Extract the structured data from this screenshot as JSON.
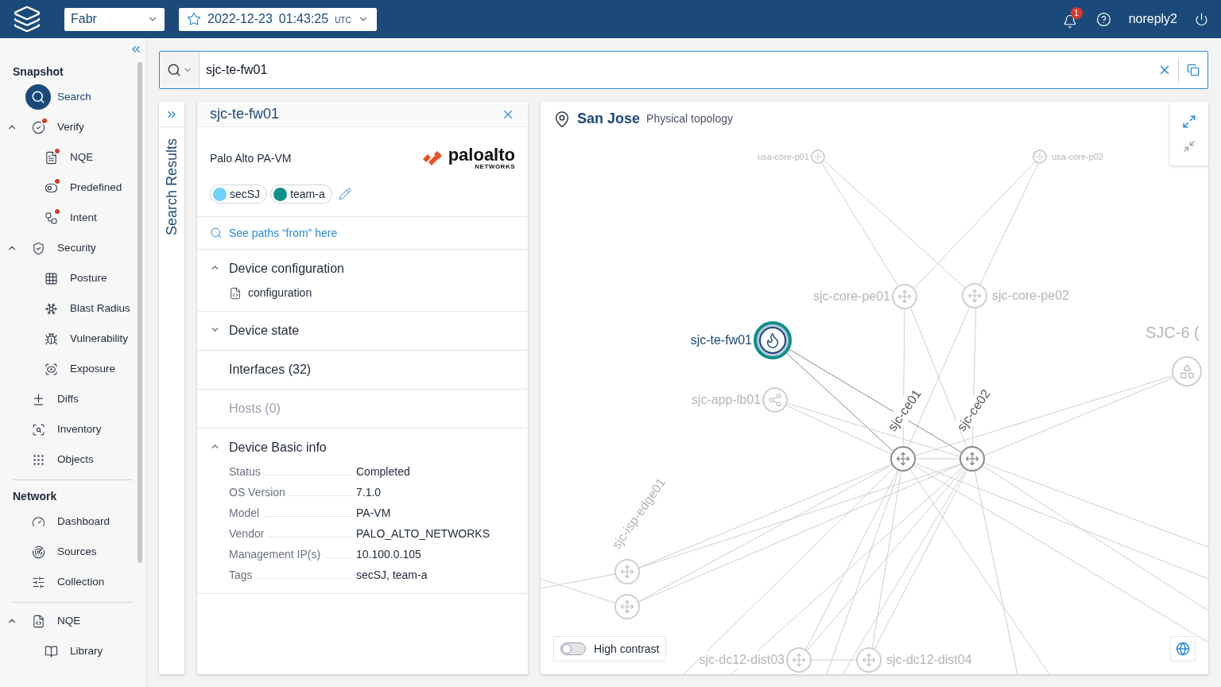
{
  "top_bar": {
    "network_select": "Fabr",
    "snapshot": {
      "date": "2022-12-23",
      "time": "01:43:25",
      "zone": "UTC",
      "starred": false
    },
    "notifications": {
      "count": "1"
    },
    "user": "noreply2"
  },
  "sidebar": {
    "sections": [
      {
        "title": "Snapshot",
        "items": [
          {
            "label": "Search",
            "selected": true,
            "alert": false
          },
          {
            "label": "Verify",
            "selected": false,
            "alert": true,
            "expanded": true,
            "children": [
              {
                "label": "NQE",
                "selected": false,
                "alert": true
              },
              {
                "label": "Predefined",
                "selected": false,
                "alert": true
              },
              {
                "label": "Intent",
                "selected": false,
                "alert": true
              }
            ]
          },
          {
            "label": "Security",
            "selected": false,
            "alert": false,
            "expanded": true,
            "children": [
              {
                "label": "Posture",
                "selected": false,
                "alert": false
              },
              {
                "label": "Blast Radius",
                "selected": false,
                "alert": false
              },
              {
                "label": "Vulnerability",
                "selected": false,
                "alert": false
              },
              {
                "label": "Exposure",
                "selected": false,
                "alert": false
              }
            ]
          },
          {
            "label": "Diffs",
            "selected": false,
            "alert": false
          },
          {
            "label": "Inventory",
            "selected": false,
            "alert": false
          },
          {
            "label": "Objects",
            "selected": false,
            "alert": false
          }
        ]
      },
      {
        "title": "Network",
        "items": [
          {
            "label": "Dashboard",
            "selected": false,
            "alert": false
          },
          {
            "label": "Sources",
            "selected": false,
            "alert": false
          },
          {
            "label": "Collection",
            "selected": false,
            "alert": false
          }
        ]
      },
      {
        "items": [
          {
            "label": "NQE",
            "selected": false,
            "alert": false,
            "expanded": true,
            "children": [
              {
                "label": "Library",
                "selected": false,
                "alert": false
              }
            ]
          }
        ]
      }
    ]
  },
  "search": {
    "value": "sjc-te-fw01"
  },
  "results_strip": {
    "label": "Search Results"
  },
  "device_panel": {
    "title": "sjc-te-fw01",
    "model": "Palo Alto PA-VM",
    "logo": {
      "name": "paloalto",
      "sub": "NETWORKS"
    },
    "tags": [
      {
        "label": "secSJ",
        "color": "#6fd0fb"
      },
      {
        "label": "team-a",
        "color": "#0e8f8a"
      }
    ],
    "paths_link": "See paths “from” here",
    "sections": [
      {
        "title": "Device configuration",
        "kind": "collapsible",
        "expanded": true,
        "disabled": false,
        "items": [
          "configuration"
        ]
      },
      {
        "title": "Device state",
        "kind": "collapsible",
        "expanded": false,
        "disabled": false
      },
      {
        "title": "Interfaces (32)",
        "kind": "plain",
        "disabled": false
      },
      {
        "title": "Hosts (0)",
        "kind": "plain",
        "disabled": true
      },
      {
        "title": "Device Basic info",
        "kind": "collapsible",
        "expanded": true,
        "disabled": false,
        "fields": [
          {
            "label": "Status",
            "value": "Completed"
          },
          {
            "label": "OS Version",
            "value": "7.1.0"
          },
          {
            "label": "Model",
            "value": "PA-VM"
          },
          {
            "label": "Vendor",
            "value": "PALO_ALTO_NETWORKS"
          },
          {
            "label": "Management IP(s)",
            "value": "10.100.0.105"
          },
          {
            "label": "Tags",
            "value": "secSJ, team-a"
          }
        ]
      }
    ]
  },
  "topology": {
    "site": "San Jose",
    "subtitle": "Physical topology",
    "nodes": [
      {
        "label": "usa-core-p01",
        "kind": "router",
        "selected": false,
        "dimmed": true
      },
      {
        "label": "usa-core-p02",
        "kind": "router",
        "selected": false,
        "dimmed": true
      },
      {
        "label": "sjc-core-pe01",
        "kind": "router",
        "selected": false,
        "dimmed": true
      },
      {
        "label": "sjc-core-pe02",
        "kind": "router",
        "selected": false,
        "dimmed": true
      },
      {
        "label": "sjc-te-fw01",
        "kind": "firewall",
        "selected": true,
        "dimmed": false
      },
      {
        "label": "sjc-app-lb01",
        "kind": "load_balancer",
        "selected": false,
        "dimmed": true
      },
      {
        "label": "sjc-ce01",
        "kind": "router",
        "selected": false,
        "dimmed": false
      },
      {
        "label": "sjc-ce02",
        "kind": "router",
        "selected": false,
        "dimmed": false
      },
      {
        "label": "sjc-isp-edge01",
        "kind": "router",
        "selected": false,
        "dimmed": true
      },
      {
        "kind": "router",
        "selected": false,
        "dimmed": true
      },
      {
        "label": "sjc-dc12-dist03",
        "kind": "router",
        "selected": false,
        "dimmed": true
      },
      {
        "label": "sjc-dc12-dist04",
        "kind": "router",
        "selected": false,
        "dimmed": true
      },
      {
        "label": "SJC-6 (",
        "kind": "group",
        "selected": false,
        "dimmed": true
      }
    ],
    "high_contrast": {
      "label": "High contrast",
      "on": false
    }
  }
}
